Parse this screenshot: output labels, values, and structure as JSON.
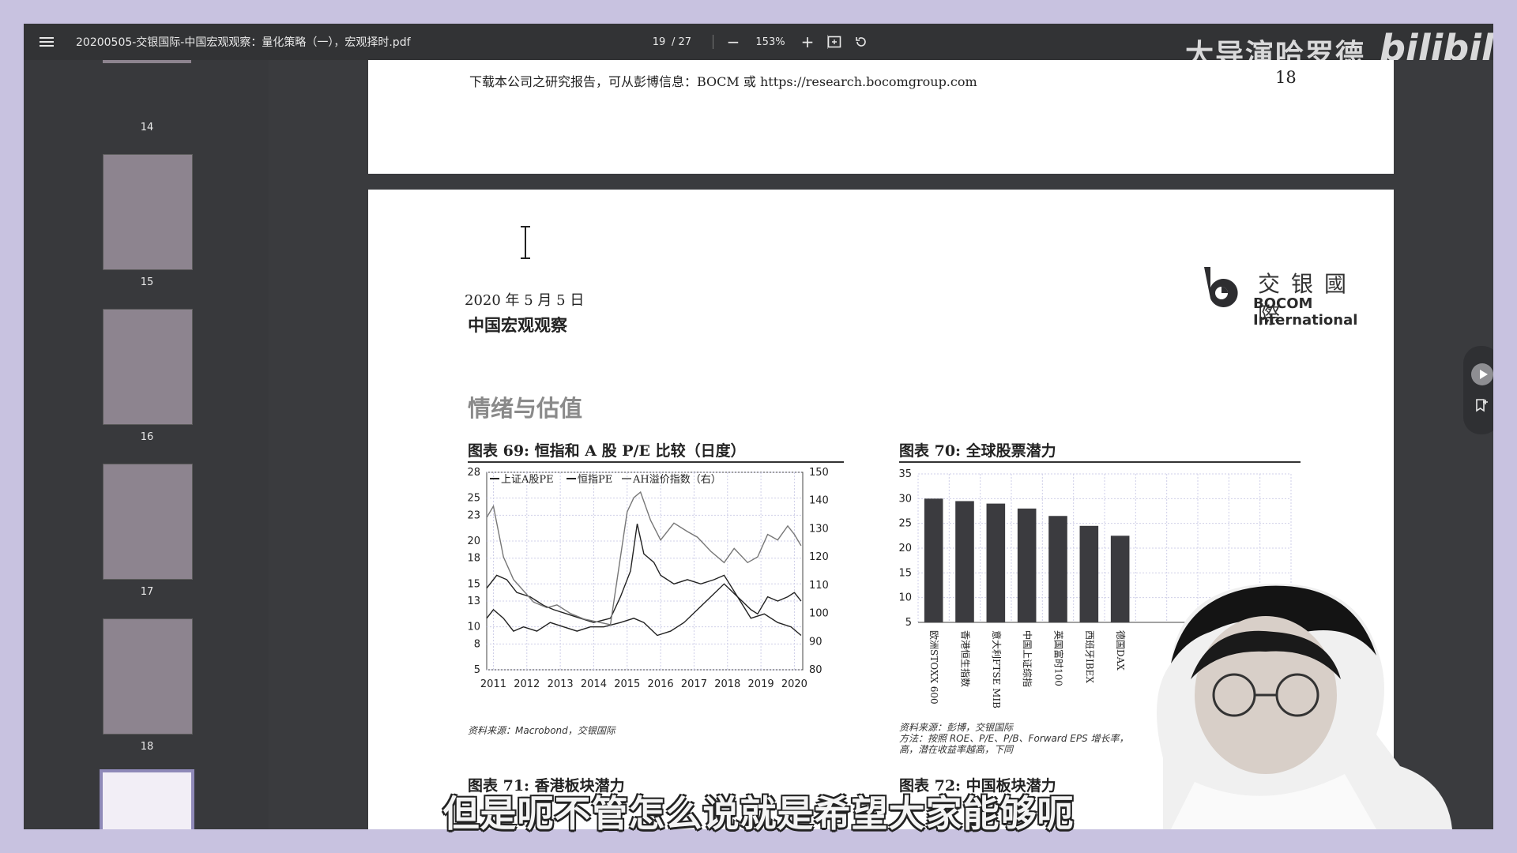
{
  "toolbar": {
    "file_title": "20200505-交银国际-中国宏观观察：量化策略（一），宏观择时.pdf",
    "page_current": "19",
    "page_total": "/ 27",
    "zoom_out": "−",
    "zoom_level": "153%",
    "zoom_in": "+"
  },
  "watermark": {
    "channel": "大导演哈罗德",
    "site_logo": "bilibili"
  },
  "sidebar": {
    "thumbnails": [
      {
        "label": "14"
      },
      {
        "label": "15"
      },
      {
        "label": "16"
      },
      {
        "label": "17"
      },
      {
        "label": "18"
      }
    ]
  },
  "page18": {
    "footer_text": "下载本公司之研究报告，可从彭博信息：BOCM 或 https://research.bocomgroup.com",
    "page_number": "18"
  },
  "page19": {
    "date": "2020 年 5 月 5 日",
    "doc_subtitle": "中国宏观观察",
    "logo_cn": "交银國際",
    "logo_en": "BOCOM International",
    "section_title": "情绪与估值",
    "fig69_title": "图表 69: 恒指和 A 股 P/E 比较（日度）",
    "fig69_source": "资料来源：Macrobond，交银国际",
    "fig70_title": "图表 70: 全球股票潜力",
    "fig70_source_1": "资料来源：彭博，交银国际",
    "fig70_source_2": "方法：按照 ROE、P/E、P/B、Forward EPS 增长率，",
    "fig70_source_3": "高，潜在收益率越高，下同",
    "fig71_caption": "图表 71: 香港板块潜力",
    "fig72_caption": "图表 72: 中国板块潜力"
  },
  "subtitle": "但是呃不管怎么说就是希望大家能够呃",
  "colors": {
    "toolbar_bg": "#323335",
    "viewer_bg": "#3a3b3e",
    "outer_border": "#c8c2e0",
    "bar_fill": "#3b3b3f"
  },
  "chart_data": [
    {
      "type": "line",
      "title": "图表 69: 恒指和 A 股 P/E 比较（日度）",
      "legend": [
        "上证A股PE",
        "恒指PE",
        "AH溢价指数（右）"
      ],
      "x_ticks": [
        "2011",
        "2012",
        "2013",
        "2014",
        "2015",
        "2016",
        "2017",
        "2018",
        "2019",
        "2020"
      ],
      "y_left_ticks": [
        5,
        8,
        10,
        13,
        15,
        18,
        20,
        23,
        25,
        28
      ],
      "y_right_ticks": [
        80,
        90,
        100,
        110,
        120,
        130,
        140,
        150
      ],
      "ylim_left": [
        5,
        28
      ],
      "ylim_right": [
        80,
        150
      ],
      "series": [
        {
          "name": "上证A股PE",
          "axis": "left",
          "x": [
            2010.9,
            2011.2,
            2011.5,
            2011.8,
            2012.2,
            2012.6,
            2012.9,
            2013.3,
            2013.7,
            2014.1,
            2014.6,
            2014.9,
            2015.2,
            2015.4,
            2015.6,
            2015.9,
            2016.1,
            2016.5,
            2016.9,
            2017.3,
            2017.7,
            2018.0,
            2018.4,
            2018.8,
            2019.0,
            2019.3,
            2019.6,
            2019.9,
            2020.1,
            2020.3
          ],
          "values": [
            14.5,
            16.0,
            15.5,
            14.0,
            13.5,
            12.5,
            12.0,
            11.5,
            11.0,
            10.5,
            11.0,
            13.5,
            16.5,
            22.0,
            18.5,
            17.5,
            16.0,
            15.0,
            15.5,
            15.0,
            15.5,
            16.0,
            13.5,
            12.0,
            11.5,
            13.5,
            13.0,
            13.5,
            14.0,
            13.0
          ]
        },
        {
          "name": "恒指PE",
          "axis": "left",
          "x": [
            2010.9,
            2011.1,
            2011.4,
            2011.7,
            2012.0,
            2012.4,
            2012.8,
            2013.2,
            2013.6,
            2014.0,
            2014.4,
            2014.9,
            2015.3,
            2015.6,
            2016.0,
            2016.4,
            2016.8,
            2017.2,
            2017.6,
            2018.0,
            2018.4,
            2018.8,
            2019.2,
            2019.6,
            2020.0,
            2020.3
          ],
          "values": [
            11.0,
            12.0,
            11.0,
            9.5,
            10.0,
            9.5,
            10.5,
            10.0,
            9.5,
            10.0,
            10.0,
            10.5,
            11.0,
            10.5,
            9.0,
            9.5,
            10.5,
            12.0,
            13.5,
            15.0,
            13.5,
            11.0,
            11.5,
            10.5,
            10.0,
            9.0
          ]
        },
        {
          "name": "AH溢价指数（右）",
          "axis": "right",
          "x": [
            2010.9,
            2011.1,
            2011.4,
            2011.7,
            2012.0,
            2012.3,
            2012.7,
            2013.0,
            2013.4,
            2013.8,
            2014.2,
            2014.6,
            2014.9,
            2015.1,
            2015.3,
            2015.5,
            2015.8,
            2016.1,
            2016.5,
            2016.9,
            2017.2,
            2017.6,
            2018.0,
            2018.3,
            2018.7,
            2019.0,
            2019.3,
            2019.6,
            2019.9,
            2020.1,
            2020.3
          ],
          "values": [
            134,
            138,
            120,
            112,
            108,
            104,
            102,
            103,
            100,
            98,
            97,
            96,
            120,
            136,
            141,
            143,
            133,
            126,
            132,
            129,
            127,
            122,
            118,
            123,
            118,
            120,
            128,
            126,
            131,
            128,
            124
          ]
        }
      ]
    },
    {
      "type": "bar",
      "title": "图表 70: 全球股票潜力",
      "categories": [
        "欧洲STOXX 600",
        "香港恒生指数",
        "意大利FTSE MIB",
        "中国上证综指",
        "英国富时100",
        "西班牙IBEX",
        "德国DAX",
        "",
        "",
        "",
        "",
        ""
      ],
      "values": [
        30.0,
        29.5,
        29.0,
        28.0,
        26.5,
        24.5,
        22.5,
        null,
        null,
        null,
        null,
        null
      ],
      "ylim": [
        5,
        35
      ],
      "y_ticks": [
        5,
        10,
        15,
        20,
        25,
        30,
        35
      ]
    }
  ]
}
